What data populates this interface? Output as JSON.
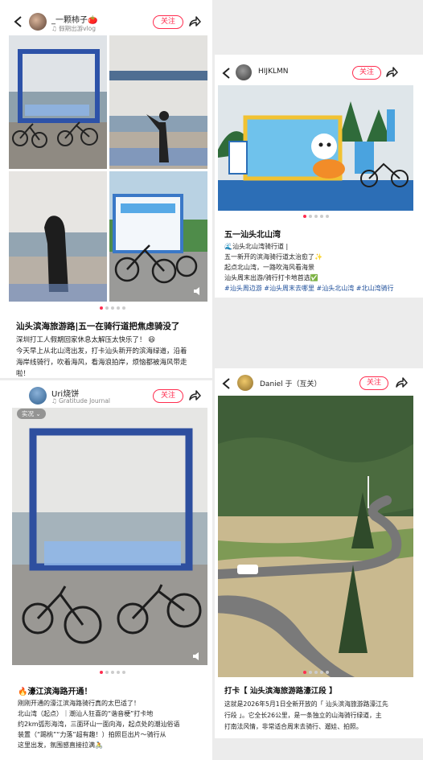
{
  "card1": {
    "user": {
      "name": "_一颗柿子🍅",
      "subtitle": "♫ 假期出游vlog"
    },
    "follow_label": "关注",
    "title": "汕头滨海旅游路|五一在骑行道把焦虑骑没了",
    "body_lines": [
      "深圳打工人假期回家休息太解压太快乐了！ 😆",
      "今天早上从北山湾出发，打卡汕头新开的滨海绿道，沿着",
      "海岸线骑行，吹着海风，看海浪拍岸，烦恼都被海风带走",
      "啦！"
    ],
    "image_texts": {
      "sign": "爱汕这片海"
    },
    "carousel": {
      "count": 5,
      "active": 0
    }
  },
  "card2": {
    "user": {
      "name": "HIJKLMN"
    },
    "follow_label": "关注",
    "title": "五一汕头北山湾",
    "body_lines": [
      "🌊汕头北山湾骑行道 |",
      "五一新开的滨海骑行道太治愈了✨",
      "起点北山湾，一路吹海风看海景",
      "汕头周末出游/骑行打卡地首选✅"
    ],
    "tags_line": "#汕头周边游 #汕头周末去哪里 #汕头北山湾 #北山湾骑行",
    "carousel": {
      "count": 5,
      "active": 0
    }
  },
  "card3": {
    "user": {
      "name": "Uri烧饼",
      "subtitle": "♫ Gratitude Journal"
    },
    "follow_label": "关注",
    "badge": "实况 ⌄",
    "title": "🔥濠江滨海路开通！",
    "body_lines": [
      "刚刚开通的濠江滨海路骑行真的太巴适了！",
      "北山湾（起点）｜潮汕人狂喜的“谐音梗”打卡地",
      "约2km弧形海湾，三面环山一面向海，起点处的潮汕俗语",
      "装置（“踢桃”“力落”超有趣！）拍照巨出片～骑行从",
      "这里出发，氛围感直接拉满🚴"
    ],
    "image_texts": {
      "sign": "爱汕这片海"
    },
    "carousel": {
      "count": 5,
      "active": 0
    }
  },
  "card4": {
    "user": {
      "name": "Daniel 于（互关）"
    },
    "follow_label": "关注",
    "title": "打卡【 汕头滨海旅游路濠江段 】",
    "body_lines": [
      "这就是2026年5月1日全新开放的「 汕头滨海旅游路濠江先",
      "行段 」。它全长26公里，是一条独立的山海骑行绿道，主",
      "打南法风情，非常适合周末去骑行、遛娃、拍照。"
    ],
    "carousel": {
      "count": 5,
      "active": 0
    }
  }
}
